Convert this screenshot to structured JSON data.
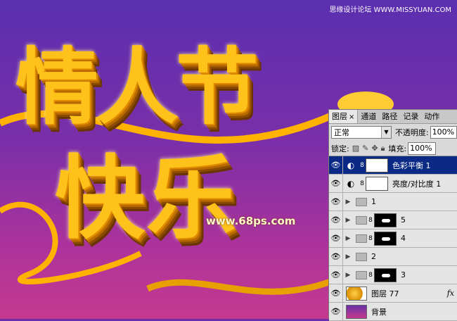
{
  "artwork": {
    "line1": "情人节",
    "line2": "快乐",
    "watermark_top": "思缘设计论坛 WWW.MISSYUAN.COM",
    "watermark_url": "www.68ps.com"
  },
  "panel": {
    "tabs": [
      "图层",
      "通道",
      "路径",
      "记录",
      "动作"
    ],
    "tab_close": "×",
    "blend_mode": "正常",
    "opacity_label": "不透明度:",
    "opacity_value": "100%",
    "lock_label": "锁定:",
    "fill_label": "填充:",
    "fill_value": "100%",
    "layers": [
      {
        "name": "色彩平衡 1",
        "selected": true
      },
      {
        "name": "亮度/对比度 1"
      },
      {
        "name": "1"
      },
      {
        "name": "5"
      },
      {
        "name": "4"
      },
      {
        "name": "2"
      },
      {
        "name": "3"
      },
      {
        "name": "图层 77",
        "fx": "fx"
      },
      {
        "name": "背景"
      }
    ]
  },
  "colors": {
    "selected_row": "#0a2a86",
    "gold": "#ffc21a",
    "background_top": "#5a2fb0",
    "background_bottom": "#c43a8e"
  }
}
